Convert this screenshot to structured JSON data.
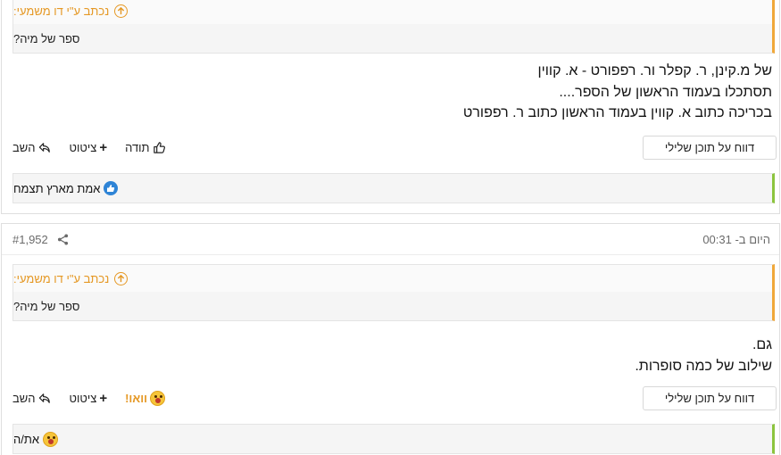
{
  "post1": {
    "quote": {
      "header": "נכתב ע\"י דו משמעי:",
      "text": "ספר של מיה?"
    },
    "body_lines": [
      "של מ.קינן, ר. קפלר ור. רפפורט - א. קווין",
      "תסתכלו בעמוד הראשון של הספר....",
      "בכריכה כתוב א. קווין בעמוד הראשון כתוב ר. רפפורט"
    ],
    "report_label": "דווח על תוכן שלילי",
    "actions": {
      "reply": "השב",
      "quote": "ציטוט",
      "like": "תודה"
    },
    "reactions": {
      "users": "אמת מארץ תצמח"
    }
  },
  "post2": {
    "meta": {
      "time": "היום ב- 00:31",
      "number": "#1,952"
    },
    "quote": {
      "header": "נכתב ע\"י דו משמעי:",
      "text": "ספר של מיה?"
    },
    "body_lines": [
      "גם.",
      "שילוב של כמה סופרות."
    ],
    "report_label": "דווח על תוכן שלילי",
    "actions": {
      "reply": "השב",
      "quote": "ציטוט",
      "reaction": "וואו!"
    },
    "reactions": {
      "users": "את/ה"
    }
  },
  "colors": {
    "quote_accent": "#e59824",
    "reaction_accent": "#8cc43e",
    "like_blue": "#2e84d6"
  },
  "icons": [
    "quote-arrow-icon",
    "reply-icon",
    "plus-icon",
    "thumbs-up-icon",
    "like-badge-icon",
    "share-icon",
    "wow-emoji-icon"
  ]
}
